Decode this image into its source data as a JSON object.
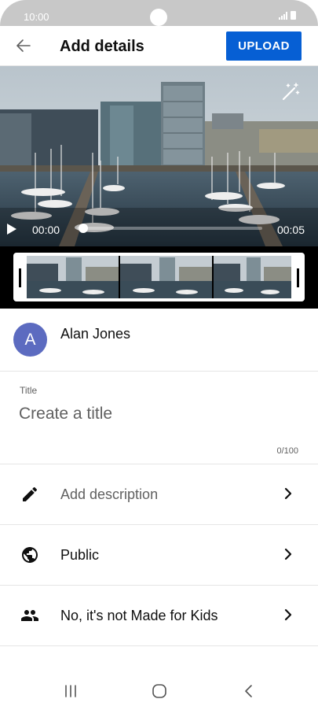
{
  "status_bar": {
    "time": "10:00"
  },
  "header": {
    "title": "Add details",
    "upload_label": "UPLOAD"
  },
  "player": {
    "current_time": "00:00",
    "duration": "00:05",
    "progress": 0
  },
  "account": {
    "initial": "A",
    "name": "Alan Jones"
  },
  "title_field": {
    "label": "Title",
    "placeholder": "Create a title",
    "value": "",
    "counter": "0/100"
  },
  "rows": [
    {
      "label": "Add description",
      "icon": "pencil-icon"
    },
    {
      "label": "Public",
      "icon": "globe-icon"
    },
    {
      "label": "No, it's not Made for Kids",
      "icon": "people-icon"
    }
  ],
  "colors": {
    "accent": "#065fd4",
    "avatar": "#5c6bc0"
  }
}
